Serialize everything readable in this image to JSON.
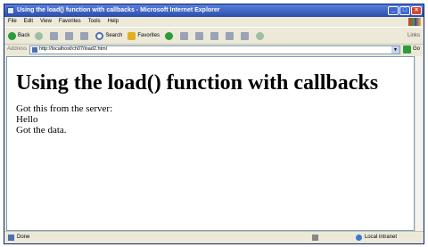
{
  "window": {
    "title": "Using the load() function with callbacks - Microsoft Internet Explorer",
    "buttons": [
      "_",
      "□",
      "×"
    ]
  },
  "menu": [
    "File",
    "Edit",
    "View",
    "Favorites",
    "Tools",
    "Help"
  ],
  "toolbar": {
    "back_label": "Back",
    "search_label": "Search",
    "favorites_label": "Favorites",
    "links_label": "Links"
  },
  "address": {
    "label": "Address",
    "url": "http://localhost/ch07/load2.html",
    "go_label": "Go"
  },
  "page": {
    "heading": "Using the load() function with callbacks",
    "lines": [
      "Got this from the server:",
      "Hello",
      "Got the data."
    ]
  },
  "status": {
    "text": "Done",
    "zone": "Local intranet"
  }
}
